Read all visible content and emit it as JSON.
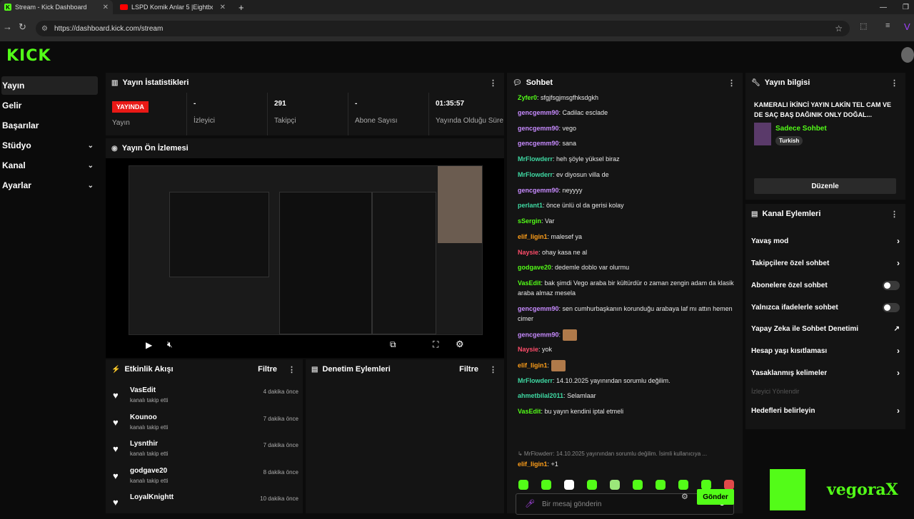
{
  "browser": {
    "tabs": [
      {
        "title": "Stream - Kick Dashboard"
      },
      {
        "title": "LSPD Komik Anlar 5 |Eightbornv"
      }
    ],
    "url": "https://dashboard.kick.com/stream"
  },
  "logo": "KICK",
  "sidebar": {
    "items": [
      {
        "label": "Yayın"
      },
      {
        "label": "Gelir"
      },
      {
        "label": "Başarılar"
      },
      {
        "label": "Stüdyo"
      },
      {
        "label": "Kanal"
      },
      {
        "label": "Ayarlar"
      }
    ]
  },
  "stats": {
    "title": "Yayın İstatistikleri",
    "live_badge": "YAYINDA",
    "items": [
      {
        "value": "",
        "label": "Yayın"
      },
      {
        "value": "-",
        "label": "İzleyici"
      },
      {
        "value": "291",
        "label": "Takipçi"
      },
      {
        "value": "-",
        "label": "Abone Sayısı"
      },
      {
        "value": "01:35:57",
        "label": "Yayında Olduğu Süre"
      }
    ]
  },
  "preview": {
    "title": "Yayın Ön İzlemesi"
  },
  "activity": {
    "title": "Etkinlik Akışı",
    "filter": "Filtre",
    "rows": [
      {
        "name": "VasEdit",
        "sub": "kanalı takip etti",
        "time": "4 dakika önce"
      },
      {
        "name": "Kounoo",
        "sub": "kanalı takip etti",
        "time": "7 dakika önce"
      },
      {
        "name": "Lysnthir",
        "sub": "kanalı takip etti",
        "time": "7 dakika önce"
      },
      {
        "name": "godgave20",
        "sub": "kanalı takip etti",
        "time": "8 dakika önce"
      },
      {
        "name": "LoyalKnightt",
        "sub": "",
        "time": "10 dakika önce"
      }
    ]
  },
  "moderation": {
    "title": "Denetim Eylemleri",
    "filter": "Filtre"
  },
  "chat": {
    "title": "Sohbet",
    "messages": [
      {
        "user": "Zyfer0",
        "color": "#53fc18",
        "text": "sfgjfsgjmsgfhksdgkh"
      },
      {
        "user": "gencgemm90",
        "color": "#c78bff",
        "text": "Cadilac esclade"
      },
      {
        "user": "gencgemm90",
        "color": "#c78bff",
        "text": "vego"
      },
      {
        "user": "gencgemm90",
        "color": "#c78bff",
        "text": "sana"
      },
      {
        "user": "MrFlowderr",
        "color": "#3fd9a3",
        "text": "heh şöyle yüksel biraz"
      },
      {
        "user": "MrFlowderr",
        "color": "#3fd9a3",
        "text": "ev diyosun villa de"
      },
      {
        "user": "gencgemm90",
        "color": "#c78bff",
        "text": "neyyyy"
      },
      {
        "user": "perlant1",
        "color": "#3fd9a3",
        "text": "önce ünlü ol da gerisi kolay"
      },
      {
        "user": "sSergin",
        "color": "#53fc18",
        "text": "Var"
      },
      {
        "user": "elif_ligin1",
        "color": "#ff9f1a",
        "text": "malesef ya"
      },
      {
        "user": "Naysie",
        "color": "#ff4d6a",
        "text": "ohay kasa ne al"
      },
      {
        "user": "godgave20",
        "color": "#53fc18",
        "text": "dedemle doblo var olurmu"
      },
      {
        "user": "VasEdit",
        "color": "#53fc18",
        "text": "bak şimdi Vego araba bir kültürdür o zaman zengin adam da klasik araba almaz mesela"
      },
      {
        "user": "gencgemm90",
        "color": "#c78bff",
        "text": "sen cumhurbaşkanın korunduğu arabaya laf mı attın hemen cimer"
      },
      {
        "user": "gencgemm90",
        "color": "#c78bff",
        "text": ""
      },
      {
        "user": "Naysie",
        "color": "#ff4d6a",
        "text": "yok"
      },
      {
        "user": "elif_ligin1",
        "color": "#ff9f1a",
        "text": ""
      },
      {
        "user": "MrFlowderr",
        "color": "#3fd9a3",
        "text": "14.10.2025 yayınından sorumlu değilim."
      },
      {
        "user": "ahmetbilal2011",
        "color": "#3fd9a3",
        "text": "Selamlaar"
      },
      {
        "user": "VasEdit",
        "color": "#53fc18",
        "text": "bu yayın kendini iptal etmeli"
      }
    ],
    "reply_preview": "↳ MrFlowderr: 14.10.2025 yayınından sorumlu değilim. İsimli kullanıcıya ...",
    "reply": {
      "user": "elif_ligin1",
      "color": "#ff9f1a",
      "text": "+1"
    },
    "input_placeholder": "Bir mesaj gönderin",
    "send_label": "Gönder"
  },
  "stream_info": {
    "title": "Yayın bilgisi",
    "stream_title": "KAMERALI İKİNCİ YAYIN LAKİN TEL CAM VE DE SAÇ BAŞ DAĞINIK ONLY DOĞAL...",
    "category": "Sadece Sohbet",
    "tag": "Turkish",
    "edit_label": "Düzenle"
  },
  "channel_actions": {
    "title": "Kanal Eylemleri",
    "items": [
      {
        "label": "Yavaş mod",
        "control": "arrow"
      },
      {
        "label": "Takipçilere özel sohbet",
        "control": "arrow"
      },
      {
        "label": "Abonelere özel sohbet",
        "control": "toggle"
      },
      {
        "label": "Yalnızca ifadelerle sohbet",
        "control": "toggle"
      },
      {
        "label": "Yapay Zeka ile Sohbet Denetimi",
        "control": "chart"
      },
      {
        "label": "Hesap yaşı kısıtlaması",
        "control": "arrow"
      },
      {
        "label": "Yasaklanmış kelimeler",
        "control": "arrow"
      },
      {
        "label": "İzleyici Yönlendir",
        "control": "none"
      },
      {
        "label": "Hedefleri belirleyin",
        "control": "arrow"
      }
    ]
  },
  "watermark": "vegoraX",
  "colors": {
    "accent": "#53fc18",
    "live": "#e91916",
    "panel": "#141414"
  }
}
